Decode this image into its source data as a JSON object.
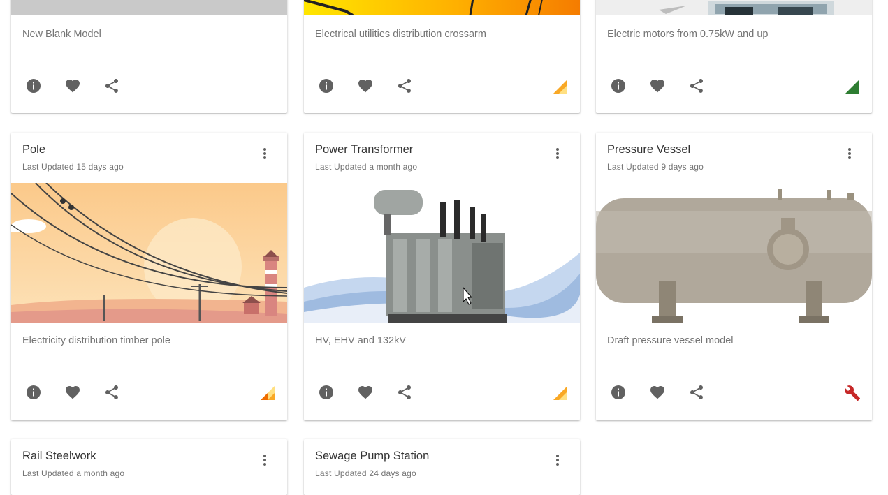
{
  "cards": [
    {
      "title": "",
      "updated": "",
      "description": "New Blank Model",
      "status": "none"
    },
    {
      "title": "",
      "updated": "",
      "description": "Electrical utilities distribution crossarm",
      "status": "amber"
    },
    {
      "title": "",
      "updated": "",
      "description": "Electric motors from 0.75kW and up",
      "status": "green"
    },
    {
      "title": "Pole",
      "updated": "Last Updated 15 days ago",
      "description": "Electricity distribution timber pole",
      "status": "orange-amber"
    },
    {
      "title": "Power Transformer",
      "updated": "Last Updated a month ago",
      "description": "HV, EHV and 132kV",
      "status": "amber"
    },
    {
      "title": "Pressure Vessel",
      "updated": "Last Updated 9 days ago",
      "description": "Draft pressure vessel model",
      "status": "draft-wrench"
    },
    {
      "title": "Rail Steelwork",
      "updated": "Last Updated a month ago",
      "description": "",
      "status": ""
    },
    {
      "title": "Sewage Pump Station",
      "updated": "Last Updated 24 days ago",
      "description": "",
      "status": ""
    }
  ],
  "icons": {
    "info": "info-icon",
    "favorite": "heart-icon",
    "share": "share-icon",
    "more": "more-vert-icon"
  },
  "colors": {
    "icon": "#616161",
    "amber": "#f9a825",
    "orange": "#ef6c00",
    "green": "#2e7d32",
    "red": "#c62828",
    "blank_media": "#c8c8c8"
  }
}
